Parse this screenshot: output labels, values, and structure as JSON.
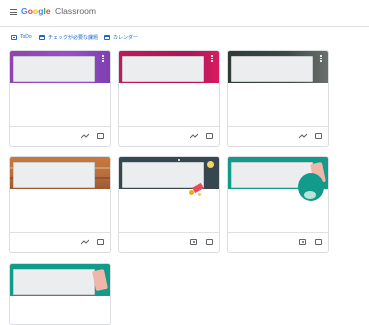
{
  "app": {
    "logo_letters": [
      "G",
      "o",
      "o",
      "g",
      "l",
      "e"
    ],
    "logo_colors": [
      "#4285f4",
      "#ea4335",
      "#fbbc05",
      "#4285f4",
      "#34a853",
      "#ea4335"
    ],
    "product": "Classroom",
    "menu_icon": "hamburger-menu-icon"
  },
  "toolbar": {
    "todo_label": "ToDo",
    "review_label": "チェックが必要な課題",
    "calendar_label": "カレンダー"
  },
  "cards": [
    {
      "theme": "purple",
      "footer_icons": [
        "trending-up-icon",
        "folder-icon"
      ]
    },
    {
      "theme": "magenta",
      "footer_icons": [
        "trending-up-icon",
        "folder-icon"
      ]
    },
    {
      "theme": "dark-green",
      "footer_icons": [
        "trending-up-icon",
        "folder-icon"
      ]
    },
    {
      "theme": "brown",
      "footer_icons": [
        "trending-up-icon",
        "folder-icon"
      ]
    },
    {
      "theme": "slate",
      "footer_icons": [
        "portrait-icon",
        "folder-icon"
      ]
    },
    {
      "theme": "teal",
      "footer_icons": [
        "portrait-icon",
        "folder-icon"
      ]
    },
    {
      "theme": "teal",
      "footer_icons": []
    }
  ],
  "colors": {
    "accent": "#1967d2",
    "purple": "#8e44ad",
    "magenta": "#c2185b",
    "dark_green": "#2f3b35",
    "brown": "#b86d3b",
    "slate": "#37474f",
    "teal": "#129a8a"
  }
}
